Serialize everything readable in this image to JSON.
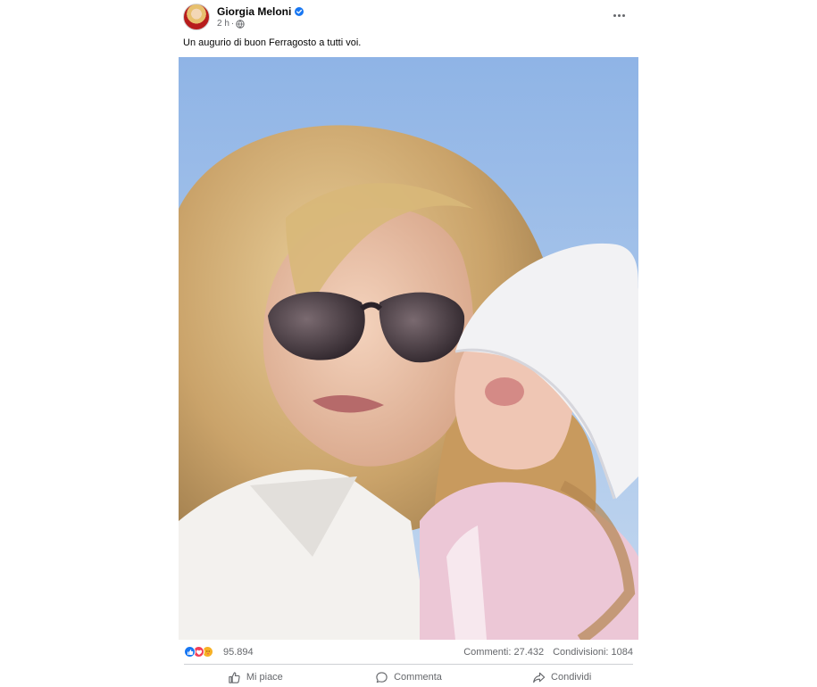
{
  "post": {
    "author": "Giorgia Meloni",
    "time": "2 h",
    "caption": "Un augurio di buon Ferragosto a tutti voi.",
    "stats": {
      "reactions_count": "95.894",
      "comments": "Commenti: 27.432",
      "shares": "Condivisioni: 1084"
    },
    "actions": {
      "like": "Mi piace",
      "comment": "Commenta",
      "share": "Condividi"
    }
  },
  "colors": {
    "accent": "#1877f2",
    "secondary_text": "#65676b",
    "love": "#f33e58",
    "care": "#f7b125"
  },
  "icons": [
    "verified-icon",
    "globe-icon",
    "more-options-icon",
    "like-reaction-icon",
    "love-reaction-icon",
    "care-reaction-icon",
    "thumbs-up-icon",
    "comment-icon",
    "share-icon"
  ]
}
